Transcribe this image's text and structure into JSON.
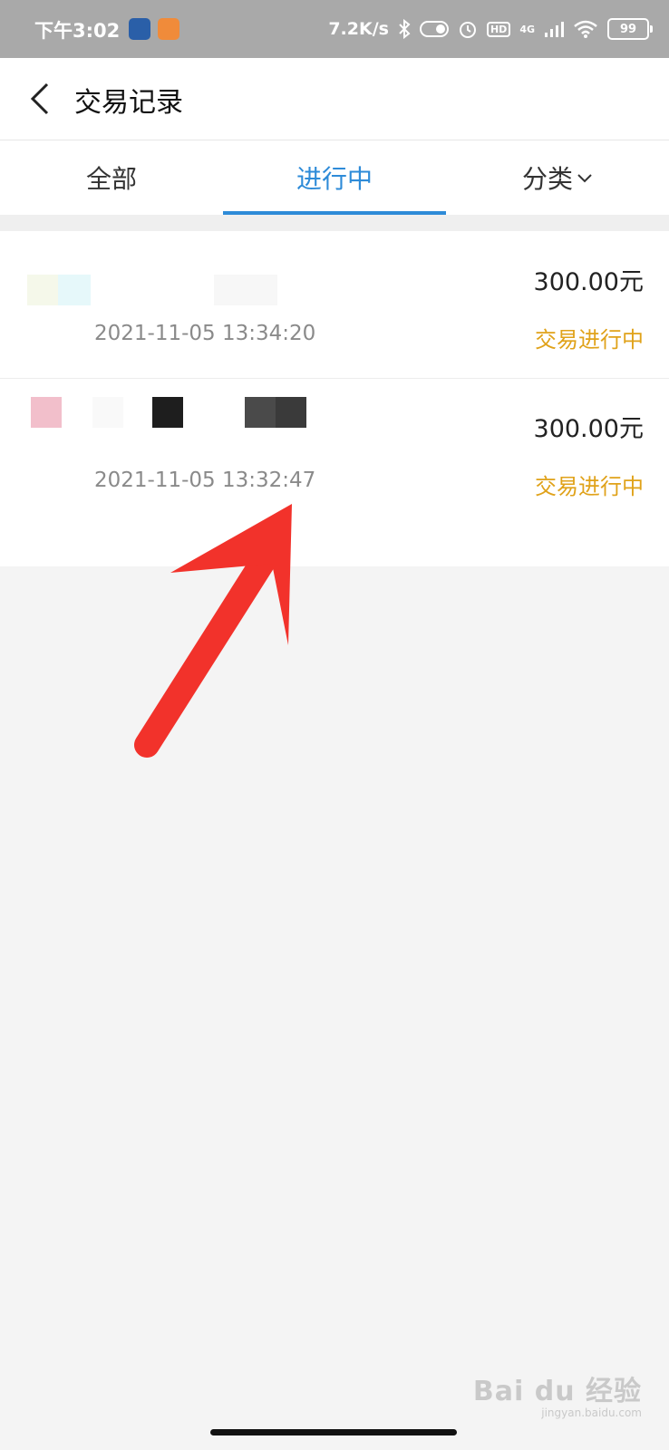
{
  "status_bar": {
    "time": "下午3:02",
    "network_speed": "7.2K/s",
    "hd": "HD",
    "signal_type": "4G",
    "battery": "99"
  },
  "header": {
    "title": "交易记录"
  },
  "tabs": [
    {
      "label": "全部",
      "active": false
    },
    {
      "label": "进行中",
      "active": true
    },
    {
      "label": "分类",
      "active": false
    }
  ],
  "transactions": [
    {
      "amount": "300.00元",
      "time": "2021-11-05 13:34:20",
      "status": "交易进行中"
    },
    {
      "amount": "300.00元",
      "time": "2021-11-05 13:32:47",
      "status": "交易进行中"
    }
  ],
  "watermark": {
    "main": "Bai du 经验",
    "sub": "jingyan.baidu.com"
  },
  "colors": {
    "accent": "#2e8bd8",
    "status_pending": "#e0a21a",
    "annotation_arrow": "#f2322b"
  }
}
